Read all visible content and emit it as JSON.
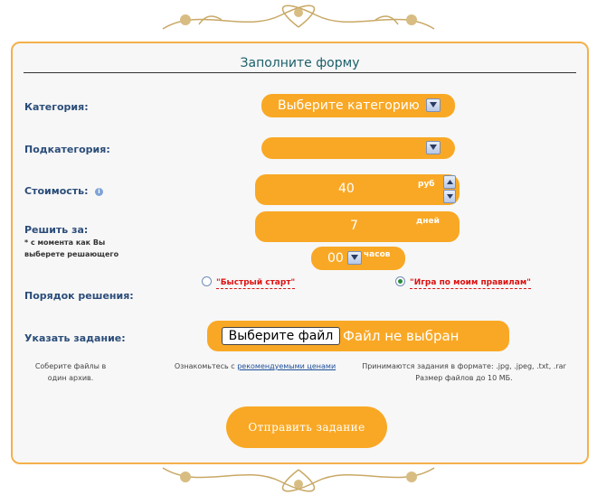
{
  "form": {
    "title": "Заполните форму",
    "category_label": "Категория:",
    "category_value": "Выберите категорию",
    "subcategory_label": "Подкатегория:",
    "subcategory_value": "",
    "cost_label": "Стоимость:",
    "cost_value": "40",
    "cost_unit": "руб",
    "solve_label": "Решить за:",
    "solve_note": "* с момента как Вы выберете решающего",
    "days_value": "7",
    "days_unit": "дней",
    "hours_value": "00",
    "hours_unit": "часов",
    "order_label": "Порядок решения:",
    "option1": "\"Быстрый старт\"",
    "option2": "\"Игра по моим правилам\"",
    "task_label": "Указать задание:",
    "file_button": "Выберите файл",
    "file_status": "Файл не выбран",
    "hint_left": "Соберите файлы в один архив.",
    "hint_mid_prefix": "Ознакомьтесь с ",
    "hint_mid_link": "рекомендуемыми ценами",
    "hint_right_1": "Принимаются задания в формате: .jpg, .jpeg, .txt, .rar",
    "hint_right_2": "Размер файлов до 10 МБ.",
    "submit": "Отправить задание"
  },
  "colors": {
    "accent": "#f9a825",
    "label": "#2b4d79",
    "border": "#f5b04a",
    "option": "#dd1111"
  },
  "icons": [
    "dropdown-arrow-icon",
    "spin-up-icon",
    "spin-down-icon",
    "info-icon",
    "ornament-icon"
  ]
}
